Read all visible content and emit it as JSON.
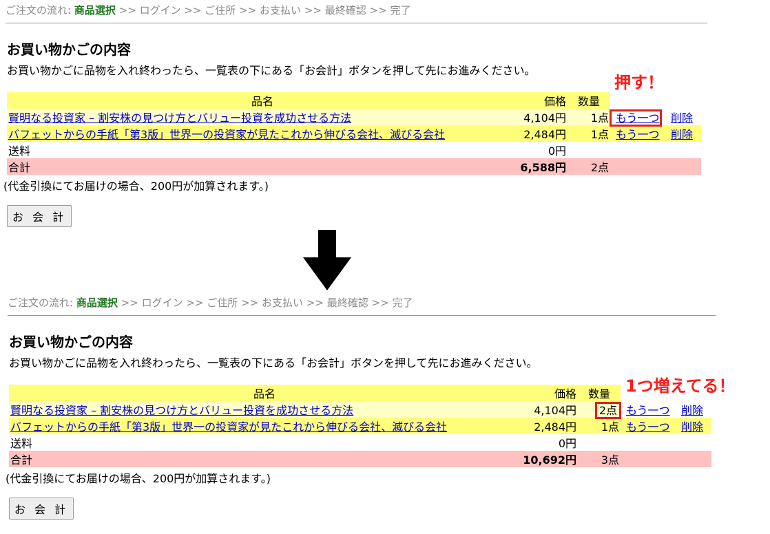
{
  "breadcrumb": {
    "prefix": "ご注文の流れ:",
    "current": "商品選択",
    "steps": [
      "ログイン",
      "ご住所",
      "お支払い",
      "最終確認",
      "完了"
    ],
    "separator": ">>"
  },
  "cart": {
    "title": "お買い物かごの内容",
    "instructions": "お買い物かごに品物を入れ終わったら、一覧表の下にある「お会計」ボタンを押して先にお進みください。",
    "headers": {
      "name": "品名",
      "price": "価格",
      "qty": "数量"
    },
    "note": "(代金引換にてお届けの場合、200円が加算されます。)",
    "checkout_label": "お 会 計",
    "one_more_label": "もう一つ",
    "delete_label": "削除",
    "shipping_label": "送料",
    "total_label": "合計"
  },
  "before": {
    "items": [
      {
        "name": "賢明なる投資家 – 割安株の見つけ方とバリュー投資を成功させる方法",
        "price": "4,104円",
        "qty": "1点"
      },
      {
        "name": "バフェットからの手紙「第3版」世界一の投資家が見たこれから伸びる会社、滅びる会社",
        "price": "2,484円",
        "qty": "1点"
      }
    ],
    "shipping": "0円",
    "total_price": "6,588円",
    "total_qty": "2点"
  },
  "after": {
    "items": [
      {
        "name": "賢明なる投資家 – 割安株の見つけ方とバリュー投資を成功させる方法",
        "price": "4,104円",
        "qty": "2点"
      },
      {
        "name": "バフェットからの手紙「第3版」世界一の投資家が見たこれから伸びる会社、滅びる会社",
        "price": "2,484円",
        "qty": "1点"
      }
    ],
    "shipping": "0円",
    "total_price": "10,692円",
    "total_qty": "3点"
  },
  "annotations": {
    "press": "押す！",
    "increased": "1つ増えてる！"
  },
  "colors": {
    "header_bg": "#ffff7a",
    "row_light_bg": "#ffffc8",
    "total_bg": "#ffc0c0",
    "link": "#0000cc",
    "highlight": "#e02020",
    "current_step": "#1f7a1f"
  }
}
